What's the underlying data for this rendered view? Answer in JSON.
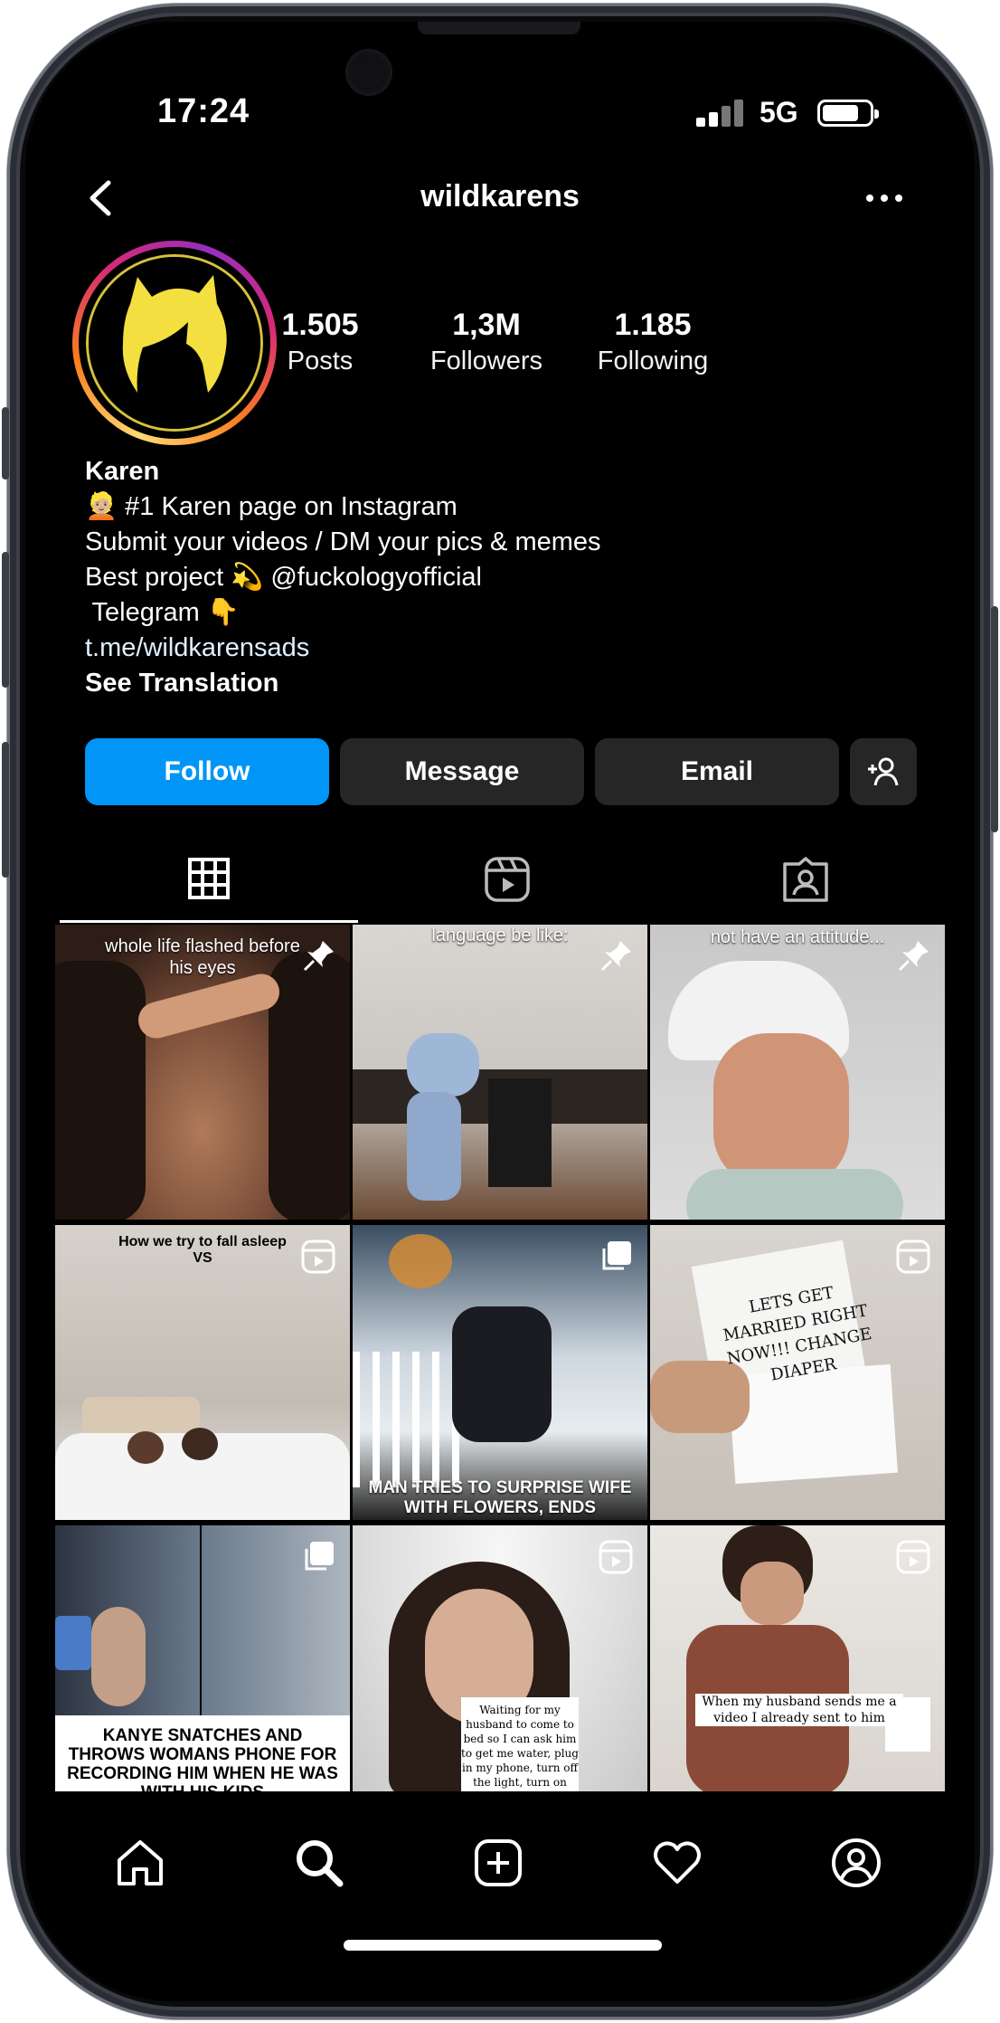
{
  "status_bar": {
    "time": "17:24",
    "network": "5G"
  },
  "header": {
    "username": "wildkarens"
  },
  "profile": {
    "stats": [
      {
        "value": "1.505",
        "label": "Posts"
      },
      {
        "value": "1,3M",
        "label": "Followers"
      },
      {
        "value": "1.185",
        "label": "Following"
      }
    ],
    "name": "Karen",
    "bio_lines": [
      "👱🏼 #1 Karen page on Instagram",
      "Submit your videos / DM your pics & memes",
      "Best project 💫 @fuckologyofficial",
      " Telegram 👇",
      "t.me/wildkarensads"
    ],
    "see_translation": "See Translation"
  },
  "actions": {
    "follow": "Follow",
    "message": "Message",
    "email": "Email"
  },
  "tabs": [
    {
      "name": "grid",
      "icon": "grid-icon",
      "active": true
    },
    {
      "name": "reels",
      "icon": "reels-icon",
      "active": false
    },
    {
      "name": "tagged",
      "icon": "tagged-icon",
      "active": false
    }
  ],
  "posts": [
    {
      "caption": "whole life flashed before his eyes",
      "type": "pinned"
    },
    {
      "caption": "language be like:",
      "type": "pinned"
    },
    {
      "caption": "not have an attitude...",
      "type": "pinned"
    },
    {
      "caption": "How we try to fall asleep VS",
      "type": "reel"
    },
    {
      "caption": "MAN TRIES TO SURPRISE WIFE WITH FLOWERS, ENDS",
      "type": "carousel"
    },
    {
      "caption": "LETS GET MARRIED RIGHT NOW!!! CHANGE DIAPER",
      "type": "reel"
    },
    {
      "caption": "KANYE SNATCHES AND THROWS WOMANS PHONE FOR RECORDING HIM WHEN HE WAS WITH HIS KIDS",
      "type": "carousel"
    },
    {
      "caption": "Waiting for my husband to come to bed so I can ask him to get me water, plug in my phone, turn off the light, turn on",
      "type": "reel"
    },
    {
      "caption": "When my husband sends me a video I already sent to him",
      "type": "reel"
    }
  ],
  "bottom_nav": [
    "home-icon",
    "search-icon",
    "create-icon",
    "heart-icon",
    "profile-icon"
  ],
  "colors": {
    "follow_button": "#0095f6",
    "button_bg": "#262626",
    "background": "#000000"
  }
}
